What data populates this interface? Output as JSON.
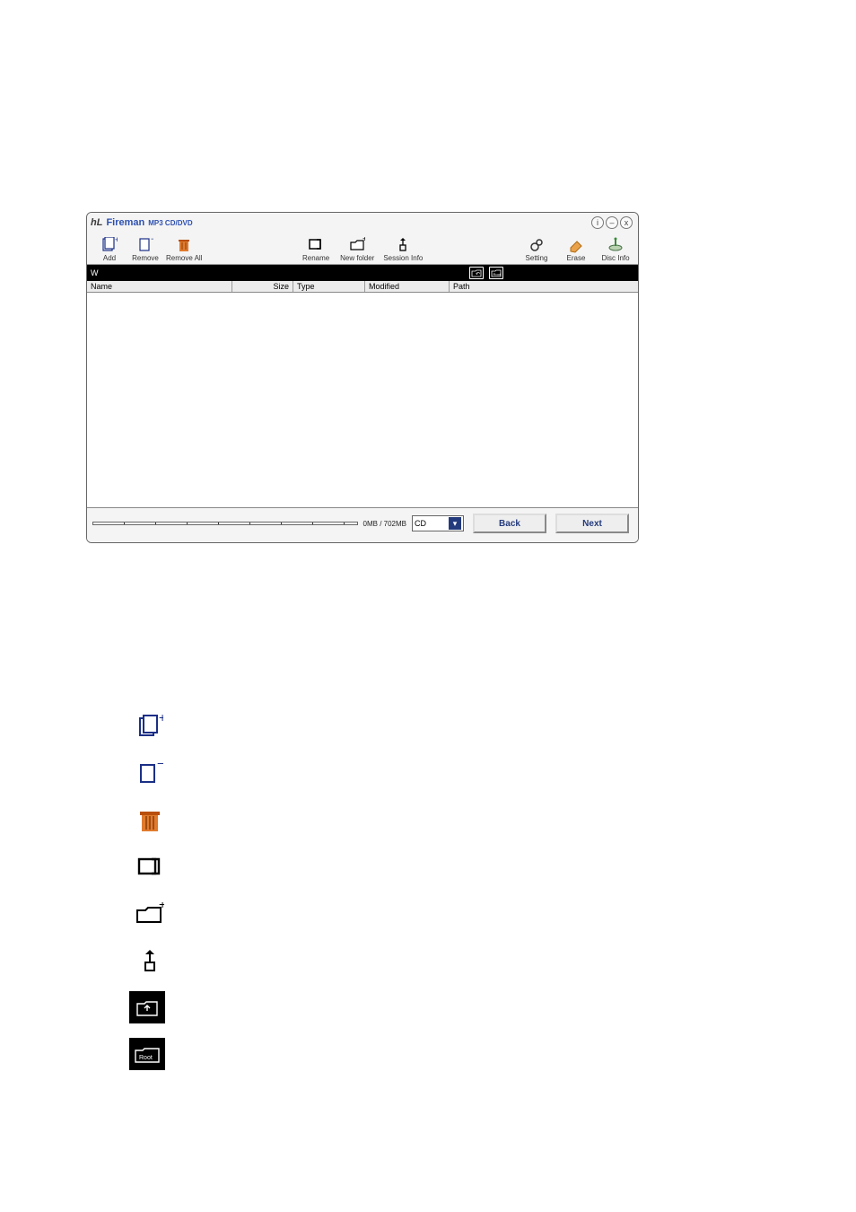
{
  "title": {
    "logo": "hL",
    "app": "Fireman",
    "sub": "MP3 CD/DVD"
  },
  "window_controls": {
    "info": "i",
    "minimize": "–",
    "close": "x"
  },
  "toolbar": {
    "left": [
      {
        "id": "add",
        "label": "Add"
      },
      {
        "id": "remove",
        "label": "Remove"
      },
      {
        "id": "remove_all",
        "label": "Remove All"
      }
    ],
    "mid": [
      {
        "id": "rename",
        "label": "Rename"
      },
      {
        "id": "new_folder",
        "label": "New folder"
      },
      {
        "id": "session_info",
        "label": "Session Info"
      }
    ],
    "right": [
      {
        "id": "setting",
        "label": "Setting"
      },
      {
        "id": "erase",
        "label": "Erase"
      },
      {
        "id": "disc_info",
        "label": "Disc Info"
      }
    ]
  },
  "pathbar": {
    "value": "W"
  },
  "columns": {
    "name": "Name",
    "size": "Size",
    "type": "Type",
    "modified": "Modified",
    "path": "Path"
  },
  "capacity": {
    "text": "0MB / 702MB"
  },
  "disc": {
    "selected": "CD"
  },
  "buttons": {
    "back": "Back",
    "next": "Next"
  },
  "legend_tooltips": {
    "add": "Add",
    "remove": "Remove",
    "remove_all": "Remove All",
    "rename": "Rename",
    "new_folder": "New folder",
    "session_info": "Session Info",
    "up": "Up folder",
    "root": "Root"
  }
}
